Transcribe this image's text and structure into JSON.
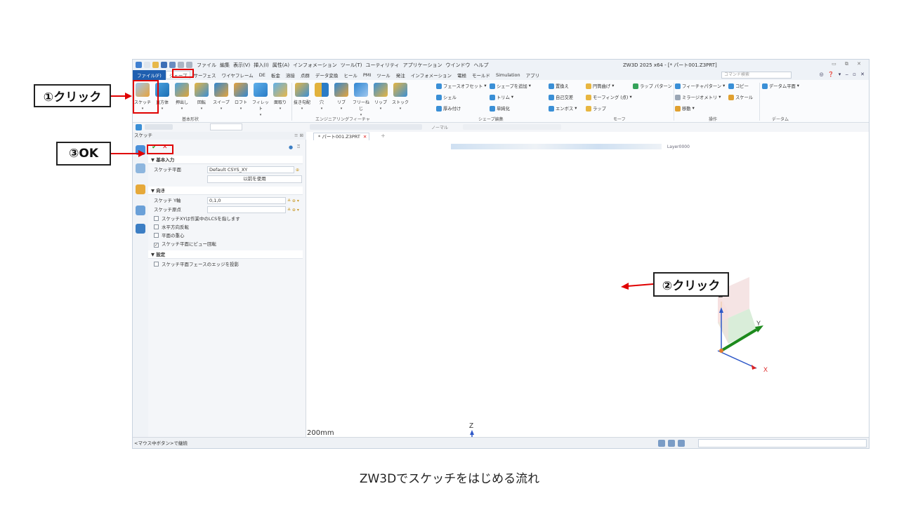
{
  "window": {
    "title": "ZW3D 2025 x64 - [* パート001.Z3PRT]",
    "quick_menu": [
      "ファイル",
      "編集",
      "表示(V)",
      "挿入(I)",
      "属性(A)",
      "インフォメーション",
      "ツール(T)",
      "ユーティリティ",
      "アプリケーション",
      "ウインドウ",
      "ヘルプ"
    ]
  },
  "menubar": {
    "file": "ファイル(F)",
    "tabs": [
      "シェープ",
      "サーフェス",
      "ワイヤフレーム",
      "DE",
      "板金",
      "溶接",
      "点群",
      "データ変換",
      "ヒール",
      "PMI",
      "ツール",
      "発注",
      "インフォメーション",
      "電極",
      "モールド",
      "Simulation",
      "アプリ"
    ],
    "search_placeholder": "コマンド検索"
  },
  "ribbon": {
    "large_buttons": [
      "スケッチ",
      "直方体",
      "押出し",
      "回転",
      "スイープ",
      "ロフト",
      "フィレット",
      "面取り",
      "抜き勾配",
      "穴",
      "リブ",
      "フリーねじ",
      "リップ",
      "ストック"
    ],
    "col1": [
      "フェースオフセット",
      "シェル",
      "厚み付け"
    ],
    "col2": [
      "シェープを追加",
      "トリム",
      "単純化"
    ],
    "col3": [
      "置換え",
      "自己交差",
      "エンボス"
    ],
    "col4": [
      "円筒曲げ",
      "モーフィング (点)",
      "ラップ"
    ],
    "col5": [
      "ラップ パターン"
    ],
    "col6": [
      "フィーチャパターン",
      "ミラージオメトリ",
      "移動"
    ],
    "col7": [
      "コピー",
      "スケール"
    ],
    "col8": [
      "データム平面"
    ],
    "groups": [
      "基本形状",
      "エンジニアリングフィーチャ",
      "シェープ編集",
      "モーフ",
      "操作",
      "データム"
    ]
  },
  "toolbar2": {
    "filter": "ノーマル",
    "layer": "Layer0000"
  },
  "panel": {
    "title": "スケッチ",
    "doc_tab": "* パート001.Z3PRT",
    "sec_basic": "▼ 基本入力",
    "sketch_plane_label": "スケッチ平面",
    "sketch_plane_value": "Default CSYS_XY",
    "use_previous": "以前を使用",
    "sec_orient": "▼ 向き",
    "y_axis_label": "スケッチ Y軸",
    "y_axis_value": "0,1,0",
    "origin_label": "スケッチ原点",
    "options": [
      {
        "label": "スケッチXYは作業中のLCSを指します",
        "checked": false
      },
      {
        "label": "水平方向反転",
        "checked": false
      },
      {
        "label": "平面の重心",
        "checked": false
      },
      {
        "label": "スケッチ平面にビュー回転",
        "checked": true
      }
    ],
    "sec_settings": "▼ 設定",
    "project_edges": "スケッチ平面フェースのエッジを投影"
  },
  "viewport": {
    "scale": "200mm",
    "axis_labels": {
      "x": "X",
      "y": "Y",
      "z": "Z"
    }
  },
  "status": {
    "hint": "<マウス中ボタン>で継続"
  },
  "annotations": {
    "step1": "①クリック",
    "step2": "②クリック",
    "step3": "③OK",
    "color": "#e00000"
  },
  "caption": "ZW3Dでスケッチをはじめる流れ"
}
